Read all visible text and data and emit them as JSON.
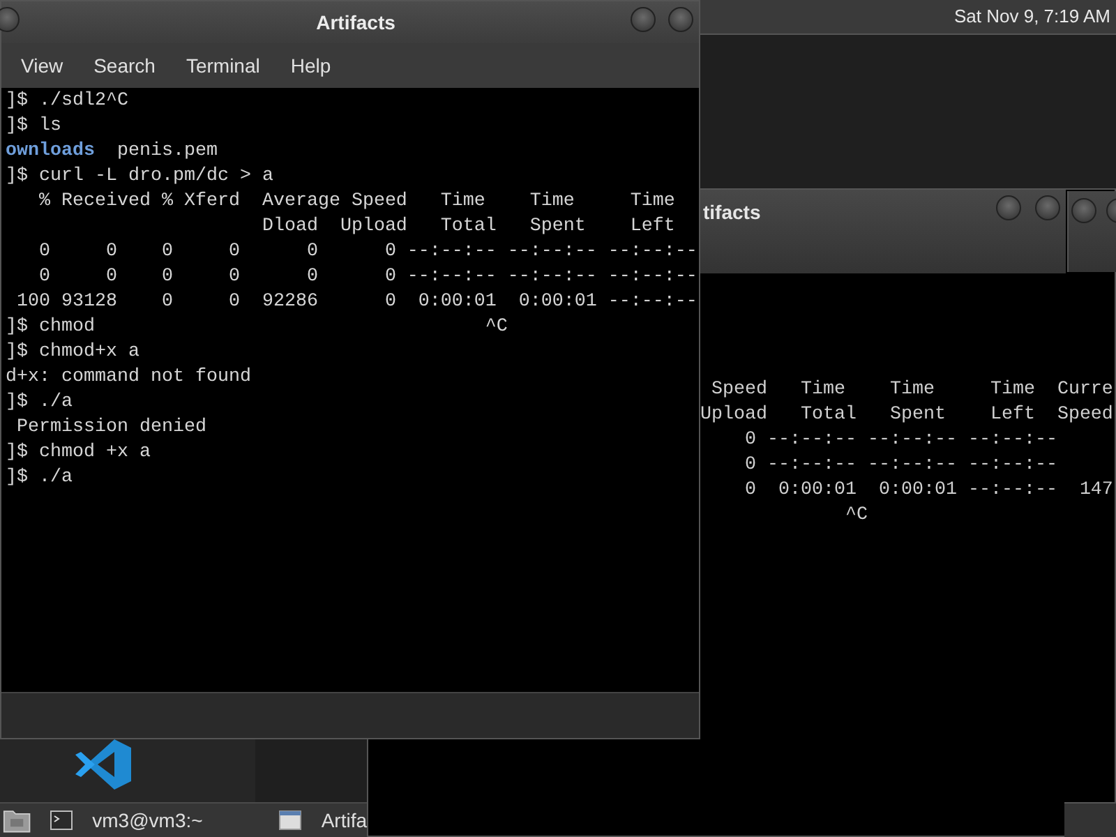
{
  "top_panel": {
    "clock": "Sat Nov 9, 7:19 AM"
  },
  "back_window": {
    "title": "tifacts",
    "lines": [
      " Speed   Time    Time     Time  Curre",
      "Upload   Total   Spent    Left  Speed",
      "    0 --:--:-- --:--:-- --:--:--",
      "    0 --:--:-- --:--:-- --:--:--",
      "    0  0:00:01  0:00:01 --:--:--  147",
      "             ^C"
    ]
  },
  "front_window": {
    "title": "Artifacts",
    "menu": [
      "View",
      "Search",
      "Terminal",
      "Help"
    ],
    "lines": [
      [
        {
          "kind": "text",
          "text": "]$ ./sdl2^C"
        }
      ],
      [
        {
          "kind": "text",
          "text": "]$ ls"
        }
      ],
      [
        {
          "kind": "dir",
          "text": "ownloads"
        },
        {
          "kind": "text",
          "text": "  penis.pem"
        }
      ],
      [
        {
          "kind": "text",
          "text": "]$ curl -L dro.pm/dc > a"
        }
      ],
      [
        {
          "kind": "text",
          "text": "   % Received % Xferd  Average Speed   Time    Time     Time"
        }
      ],
      [
        {
          "kind": "text",
          "text": "                       Dload  Upload   Total   Spent    Left"
        }
      ],
      [
        {
          "kind": "text",
          "text": "   0     0    0     0      0      0 --:--:-- --:--:-- --:--:--"
        }
      ],
      [
        {
          "kind": "text",
          "text": "   0     0    0     0      0      0 --:--:-- --:--:-- --:--:--"
        }
      ],
      [
        {
          "kind": "text",
          "text": " 100 93128    0     0  92286      0  0:00:01  0:00:01 --:--:--"
        }
      ],
      [
        {
          "kind": "text",
          "text": "]$ chmod                                   ^C"
        }
      ],
      [
        {
          "kind": "text",
          "text": "]$ chmod+x a"
        }
      ],
      [
        {
          "kind": "text",
          "text": "d+x: command not found"
        }
      ],
      [
        {
          "kind": "text",
          "text": "]$ ./a"
        }
      ],
      [
        {
          "kind": "text",
          "text": " Permission denied"
        }
      ],
      [
        {
          "kind": "text",
          "text": "]$ chmod +x a"
        }
      ],
      [
        {
          "kind": "text",
          "text": "]$ ./a"
        }
      ]
    ]
  },
  "taskbar": {
    "items": [
      {
        "kind": "terminal",
        "label": "vm3@vm3:~"
      },
      {
        "kind": "window",
        "label": "Artifa"
      }
    ]
  }
}
